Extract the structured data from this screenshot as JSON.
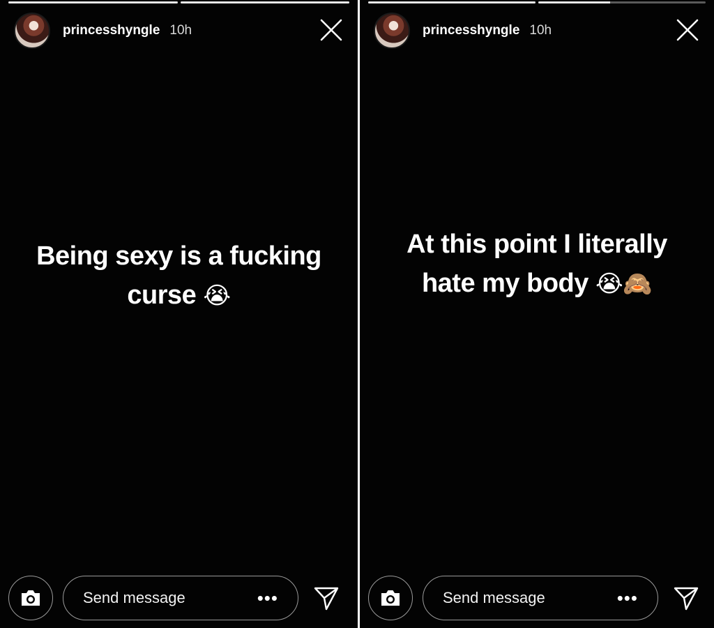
{
  "stories": [
    {
      "progress": [
        1.0,
        1.0
      ],
      "username": "princesshyngle",
      "time": "10h",
      "caption_line1": "Being sexy is a fucking",
      "caption_line2": "curse",
      "caption_emoji": "😭",
      "message_placeholder": "Send message",
      "more_label": "•••",
      "icons": [
        "avatar",
        "close-icon",
        "camera-icon",
        "more-icon",
        "send-icon"
      ]
    },
    {
      "progress": [
        1.0,
        0.43
      ],
      "username": "princesshyngle",
      "time": "10h",
      "caption_line1": "At this point I literally",
      "caption_line2": "hate my body",
      "caption_emoji": "😭🙈",
      "message_placeholder": "Send message",
      "more_label": "•••",
      "icons": [
        "avatar",
        "close-icon",
        "camera-icon",
        "more-icon",
        "send-icon"
      ]
    }
  ],
  "colors": {
    "background": "#030303",
    "text": "#ffffff",
    "timestamp": "#d9d9d9",
    "outline": "#9a9a9a"
  }
}
